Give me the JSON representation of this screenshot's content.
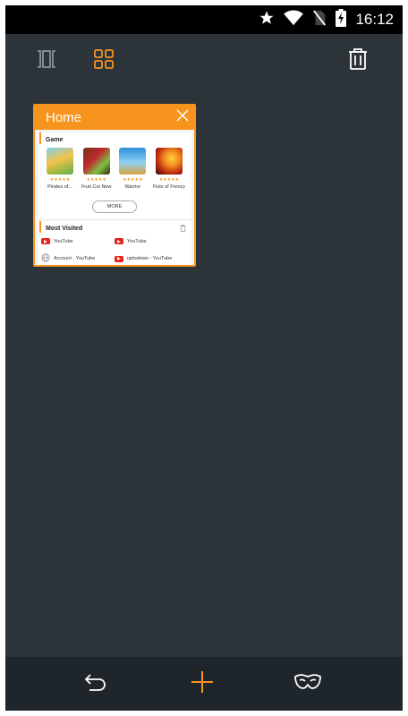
{
  "status_bar": {
    "time": "16:12",
    "icons": [
      "star-icon",
      "wifi-icon",
      "no-sim-icon",
      "battery-charging-icon"
    ]
  },
  "toolbar": {
    "icons": [
      "list-view-icon",
      "grid-view-icon",
      "trash-icon"
    ]
  },
  "tab_card": {
    "title": "Home",
    "game_section": {
      "title": "Game",
      "games": [
        {
          "name": "Pirates of..."
        },
        {
          "name": "Fruit Cut New"
        },
        {
          "name": "Warrior"
        },
        {
          "name": "Fists of Frenzy"
        }
      ],
      "more_label": "MORE"
    },
    "most_visited": {
      "title": "Most Visited",
      "items": [
        {
          "label": "YouTube",
          "icon": "youtube-icon"
        },
        {
          "label": "YouTube",
          "icon": "youtube-icon"
        },
        {
          "label": "Account - YouTube",
          "icon": "globe-icon"
        },
        {
          "label": "uptodown - YouTube",
          "icon": "youtube-icon"
        }
      ]
    }
  },
  "bottom_bar": {
    "icons": [
      "back-icon",
      "add-tab-icon",
      "incognito-mask-icon"
    ]
  },
  "colors": {
    "accent": "#f7941d",
    "background": "#2c343a",
    "bottom_bar": "#1f262b"
  }
}
